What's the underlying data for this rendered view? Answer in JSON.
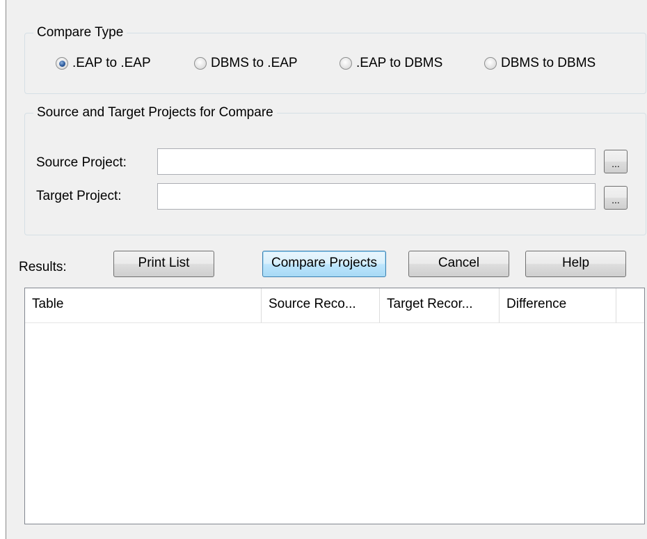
{
  "compare_type": {
    "title": "Compare Type",
    "options": [
      {
        "label": ".EAP to .EAP",
        "checked": true
      },
      {
        "label": "DBMS to .EAP",
        "checked": false
      },
      {
        "label": ".EAP to DBMS",
        "checked": false
      },
      {
        "label": "DBMS to DBMS",
        "checked": false
      }
    ]
  },
  "projects": {
    "title": "Source and Target Projects for Compare",
    "source_label": "Source Project:",
    "source_value": "",
    "target_label": "Target Project:",
    "target_value": "",
    "browse_label": "..."
  },
  "results": {
    "label": "Results:",
    "columns": [
      "Table",
      "Source Reco...",
      "Target Recor...",
      "Difference"
    ],
    "rows": []
  },
  "buttons": {
    "print_list": "Print List",
    "compare_projects": "Compare Projects",
    "cancel": "Cancel",
    "help": "Help"
  }
}
